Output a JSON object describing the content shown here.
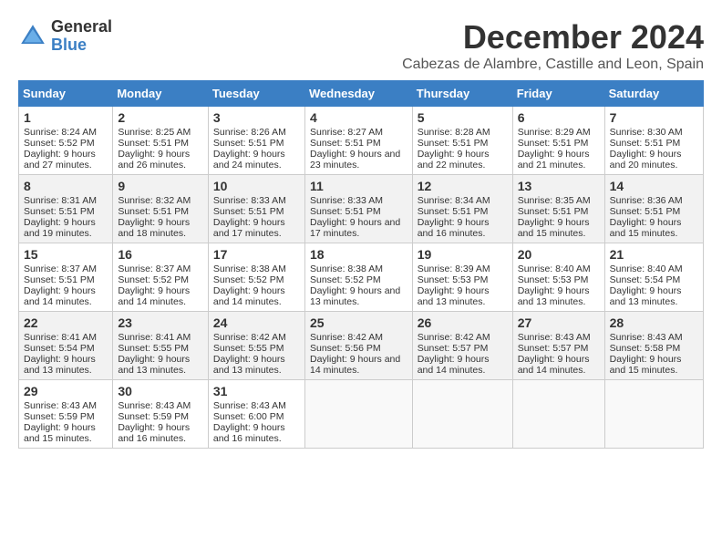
{
  "logo": {
    "general": "General",
    "blue": "Blue"
  },
  "title": "December 2024",
  "subtitle": "Cabezas de Alambre, Castille and Leon, Spain",
  "days_of_week": [
    "Sunday",
    "Monday",
    "Tuesday",
    "Wednesday",
    "Thursday",
    "Friday",
    "Saturday"
  ],
  "weeks": [
    [
      {
        "day": "1",
        "sunrise": "8:24 AM",
        "sunset": "5:52 PM",
        "daylight": "9 hours and 27 minutes."
      },
      {
        "day": "2",
        "sunrise": "8:25 AM",
        "sunset": "5:51 PM",
        "daylight": "9 hours and 26 minutes."
      },
      {
        "day": "3",
        "sunrise": "8:26 AM",
        "sunset": "5:51 PM",
        "daylight": "9 hours and 24 minutes."
      },
      {
        "day": "4",
        "sunrise": "8:27 AM",
        "sunset": "5:51 PM",
        "daylight": "9 hours and 23 minutes."
      },
      {
        "day": "5",
        "sunrise": "8:28 AM",
        "sunset": "5:51 PM",
        "daylight": "9 hours and 22 minutes."
      },
      {
        "day": "6",
        "sunrise": "8:29 AM",
        "sunset": "5:51 PM",
        "daylight": "9 hours and 21 minutes."
      },
      {
        "day": "7",
        "sunrise": "8:30 AM",
        "sunset": "5:51 PM",
        "daylight": "9 hours and 20 minutes."
      }
    ],
    [
      {
        "day": "8",
        "sunrise": "8:31 AM",
        "sunset": "5:51 PM",
        "daylight": "9 hours and 19 minutes."
      },
      {
        "day": "9",
        "sunrise": "8:32 AM",
        "sunset": "5:51 PM",
        "daylight": "9 hours and 18 minutes."
      },
      {
        "day": "10",
        "sunrise": "8:33 AM",
        "sunset": "5:51 PM",
        "daylight": "9 hours and 17 minutes."
      },
      {
        "day": "11",
        "sunrise": "8:33 AM",
        "sunset": "5:51 PM",
        "daylight": "9 hours and 17 minutes."
      },
      {
        "day": "12",
        "sunrise": "8:34 AM",
        "sunset": "5:51 PM",
        "daylight": "9 hours and 16 minutes."
      },
      {
        "day": "13",
        "sunrise": "8:35 AM",
        "sunset": "5:51 PM",
        "daylight": "9 hours and 15 minutes."
      },
      {
        "day": "14",
        "sunrise": "8:36 AM",
        "sunset": "5:51 PM",
        "daylight": "9 hours and 15 minutes."
      }
    ],
    [
      {
        "day": "15",
        "sunrise": "8:37 AM",
        "sunset": "5:51 PM",
        "daylight": "9 hours and 14 minutes."
      },
      {
        "day": "16",
        "sunrise": "8:37 AM",
        "sunset": "5:52 PM",
        "daylight": "9 hours and 14 minutes."
      },
      {
        "day": "17",
        "sunrise": "8:38 AM",
        "sunset": "5:52 PM",
        "daylight": "9 hours and 14 minutes."
      },
      {
        "day": "18",
        "sunrise": "8:38 AM",
        "sunset": "5:52 PM",
        "daylight": "9 hours and 13 minutes."
      },
      {
        "day": "19",
        "sunrise": "8:39 AM",
        "sunset": "5:53 PM",
        "daylight": "9 hours and 13 minutes."
      },
      {
        "day": "20",
        "sunrise": "8:40 AM",
        "sunset": "5:53 PM",
        "daylight": "9 hours and 13 minutes."
      },
      {
        "day": "21",
        "sunrise": "8:40 AM",
        "sunset": "5:54 PM",
        "daylight": "9 hours and 13 minutes."
      }
    ],
    [
      {
        "day": "22",
        "sunrise": "8:41 AM",
        "sunset": "5:54 PM",
        "daylight": "9 hours and 13 minutes."
      },
      {
        "day": "23",
        "sunrise": "8:41 AM",
        "sunset": "5:55 PM",
        "daylight": "9 hours and 13 minutes."
      },
      {
        "day": "24",
        "sunrise": "8:42 AM",
        "sunset": "5:55 PM",
        "daylight": "9 hours and 13 minutes."
      },
      {
        "day": "25",
        "sunrise": "8:42 AM",
        "sunset": "5:56 PM",
        "daylight": "9 hours and 14 minutes."
      },
      {
        "day": "26",
        "sunrise": "8:42 AM",
        "sunset": "5:57 PM",
        "daylight": "9 hours and 14 minutes."
      },
      {
        "day": "27",
        "sunrise": "8:43 AM",
        "sunset": "5:57 PM",
        "daylight": "9 hours and 14 minutes."
      },
      {
        "day": "28",
        "sunrise": "8:43 AM",
        "sunset": "5:58 PM",
        "daylight": "9 hours and 15 minutes."
      }
    ],
    [
      {
        "day": "29",
        "sunrise": "8:43 AM",
        "sunset": "5:59 PM",
        "daylight": "9 hours and 15 minutes."
      },
      {
        "day": "30",
        "sunrise": "8:43 AM",
        "sunset": "5:59 PM",
        "daylight": "9 hours and 16 minutes."
      },
      {
        "day": "31",
        "sunrise": "8:43 AM",
        "sunset": "6:00 PM",
        "daylight": "9 hours and 16 minutes."
      },
      null,
      null,
      null,
      null
    ]
  ]
}
